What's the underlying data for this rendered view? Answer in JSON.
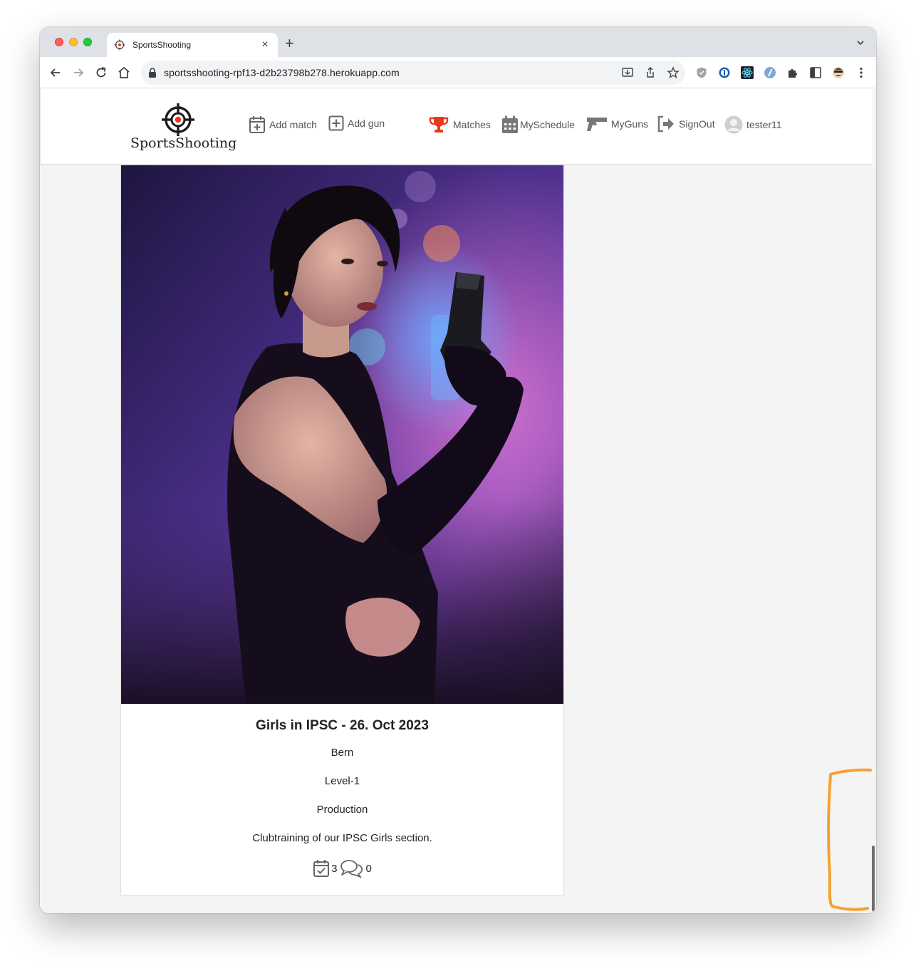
{
  "browser": {
    "tab_title": "SportsShooting",
    "new_tab_symbol": "+",
    "tab_close_symbol": "×",
    "url": "sportsshooting-rpf13-d2b23798b278.herokuapp.com"
  },
  "navbar": {
    "logo_text": "SportsShooting",
    "items": [
      {
        "label": "Add match",
        "icon": "plus-square-icon"
      },
      {
        "label": "Add gun",
        "icon": "plus-square-icon"
      },
      {
        "label": "Matches",
        "icon": "trophy-icon",
        "color": "#e8391c"
      },
      {
        "label": "MySchedule",
        "icon": "calendar-icon"
      },
      {
        "label": "MyGuns",
        "icon": "gun-icon"
      },
      {
        "label": "SignOut",
        "icon": "sign-out-icon"
      },
      {
        "label": "tester11",
        "icon": "avatar-icon"
      }
    ]
  },
  "match_card": {
    "title": "Girls in IPSC - 26. Oct 2023",
    "location": "Bern",
    "level": "Level-1",
    "division": "Production",
    "description": "Clubtraining of our IPSC Girls section.",
    "attendees_count": "3",
    "comments_count": "0"
  },
  "colors": {
    "accent_orange_annotation": "#f5a033",
    "trophy_red": "#e8391c",
    "page_background": "#f4f4f4"
  }
}
